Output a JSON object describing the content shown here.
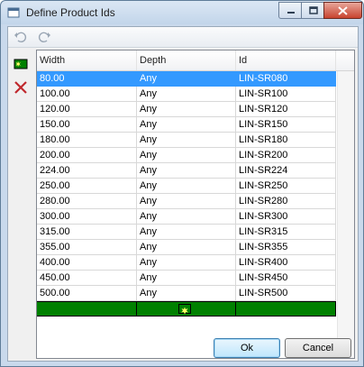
{
  "window": {
    "title": "Define Product Ids",
    "controls": {
      "minimize": "minimize",
      "maximize": "maximize",
      "close": "close"
    }
  },
  "toolbar": {
    "undo_icon": "undo-icon",
    "redo_icon": "redo-icon"
  },
  "side": {
    "add_icon": "add-row-icon",
    "delete_icon": "delete-row-icon"
  },
  "grid": {
    "columns": [
      "Width",
      "Depth",
      "Id"
    ],
    "rows": [
      {
        "width": "80.00",
        "depth": "Any",
        "id": "LIN-SR080"
      },
      {
        "width": "100.00",
        "depth": "Any",
        "id": "LIN-SR100"
      },
      {
        "width": "120.00",
        "depth": "Any",
        "id": "LIN-SR120"
      },
      {
        "width": "150.00",
        "depth": "Any",
        "id": "LIN-SR150"
      },
      {
        "width": "180.00",
        "depth": "Any",
        "id": "LIN-SR180"
      },
      {
        "width": "200.00",
        "depth": "Any",
        "id": "LIN-SR200"
      },
      {
        "width": "224.00",
        "depth": "Any",
        "id": "LIN-SR224"
      },
      {
        "width": "250.00",
        "depth": "Any",
        "id": "LIN-SR250"
      },
      {
        "width": "280.00",
        "depth": "Any",
        "id": "LIN-SR280"
      },
      {
        "width": "300.00",
        "depth": "Any",
        "id": "LIN-SR300"
      },
      {
        "width": "315.00",
        "depth": "Any",
        "id": "LIN-SR315"
      },
      {
        "width": "355.00",
        "depth": "Any",
        "id": "LIN-SR355"
      },
      {
        "width": "400.00",
        "depth": "Any",
        "id": "LIN-SR400"
      },
      {
        "width": "450.00",
        "depth": "Any",
        "id": "LIN-SR450"
      },
      {
        "width": "500.00",
        "depth": "Any",
        "id": "LIN-SR500"
      }
    ],
    "selected_row": 0,
    "new_row_color": "#008000",
    "selection_color": "#3399ff"
  },
  "buttons": {
    "ok": "Ok",
    "cancel": "Cancel"
  }
}
